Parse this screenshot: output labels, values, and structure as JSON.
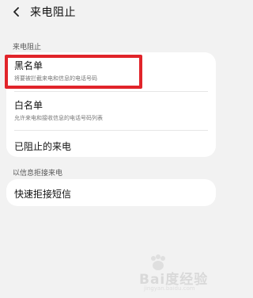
{
  "header": {
    "title": "来电阻止",
    "back_icon": "chevron-left-icon"
  },
  "section1": {
    "label": "来电阻止"
  },
  "items": [
    {
      "title": "黑名单",
      "subtitle": "将要被拦截来电和信息的电话号码"
    },
    {
      "title": "白名单",
      "subtitle": "允许来电和接收信息的电话号码列表"
    },
    {
      "title": "已阻止的来电"
    }
  ],
  "section2": {
    "label": "以信息拒接来电"
  },
  "quick_reply": {
    "title": "快速拒接短信"
  },
  "watermark": {
    "logo": "Bai度经验",
    "url": "jingyan.baidu.com"
  },
  "colors": {
    "highlight": "#e1242a",
    "background": "#f2f2f2",
    "card": "#ffffff"
  }
}
